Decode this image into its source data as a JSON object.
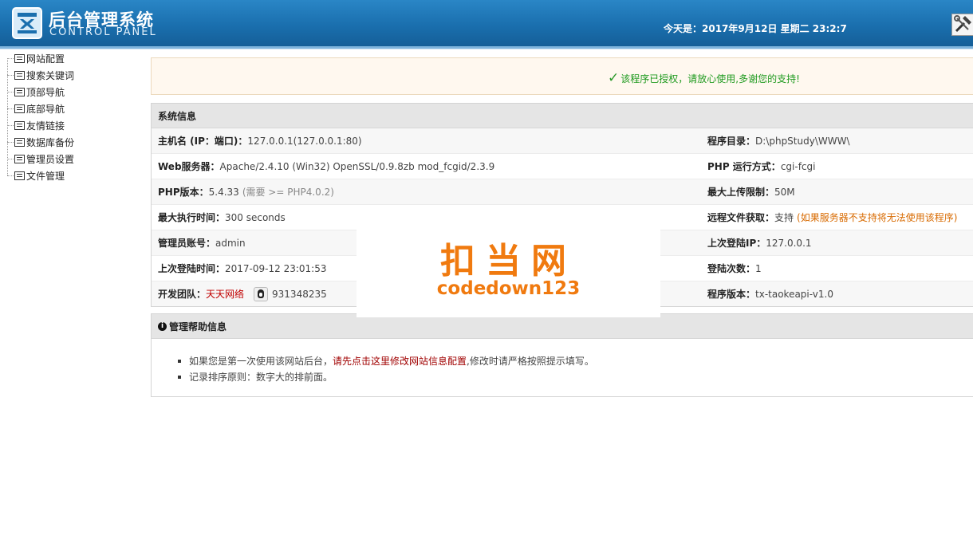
{
  "header": {
    "title_cn": "后台管理系统",
    "title_en": "CONTROL PANEL",
    "datetime": "今天是：2017年9月12日 星期二 23:2:7",
    "logo_icon": "x-badge-logo",
    "tools_icon": "tools-icon"
  },
  "sidebar": {
    "items": [
      {
        "label": "网站配置"
      },
      {
        "label": "搜索关键词"
      },
      {
        "label": "顶部导航"
      },
      {
        "label": "底部导航"
      },
      {
        "label": "友情链接"
      },
      {
        "label": "数据库备份"
      },
      {
        "label": "管理员设置"
      },
      {
        "label": "文件管理"
      }
    ]
  },
  "notice": {
    "text": "该程序已授权，请放心使用,多谢您的支持!"
  },
  "system_info": {
    "title": "系统信息",
    "host_label": "主机名 (IP：端口)：",
    "host_value": "127.0.0.1(127.0.0.1:80)",
    "dir_label": "程序目录：",
    "dir_value": "D:\\phpStudy\\WWW\\",
    "web_label": "Web服务器：",
    "web_value": "Apache/2.4.10 (Win32) OpenSSL/0.9.8zb mod_fcgid/2.3.9",
    "php_mode_label": "PHP 运行方式：",
    "php_mode_value": "cgi-fcgi",
    "php_ver_label": "PHP版本：",
    "php_ver_value": "5.4.33",
    "php_ver_note": "(需要 >= PHP4.0.2)",
    "upload_label": "最大上传限制：",
    "upload_value": "50M",
    "exec_label": "最大执行时间：",
    "exec_value": "300 seconds",
    "remote_label": "远程文件获取：",
    "remote_value": "支持",
    "remote_note": "(如果服务器不支持将无法使用该程序)",
    "admin_label": "管理员账号：",
    "admin_value": "admin",
    "lastip_label": "上次登陆IP：",
    "lastip_value": "127.0.0.1",
    "lasttime_label": "上次登陆时间：",
    "lasttime_value": "2017-09-12 23:01:53",
    "logins_label": "登陆次数：",
    "logins_value": "1",
    "team_label": "开发团队：",
    "team_value": "天天网络",
    "qq_value": "931348235",
    "version_label": "程序版本：",
    "version_value": "tx-taokeapi-v1.0"
  },
  "help": {
    "title": "管理帮助信息",
    "item1_prefix": "如果您是第一次使用该网站后台，",
    "item1_link": "请先点击这里修改网站信息配置",
    "item1_suffix": ",修改时请严格按照提示填写。",
    "item2": "记录排序原则：数字大的排前面。"
  },
  "watermark": {
    "cn": "扣当网",
    "en": "codedown123"
  }
}
